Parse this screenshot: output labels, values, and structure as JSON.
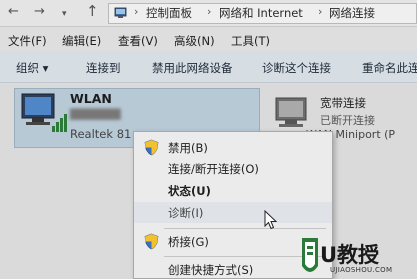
{
  "address_bar": {
    "breadcrumbs": [
      "控制面板",
      "网络和 Internet",
      "网络连接"
    ],
    "separator": "›"
  },
  "menubar": {
    "items": [
      "文件(F)",
      "编辑(E)",
      "查看(V)",
      "高级(N)",
      "工具(T)"
    ]
  },
  "toolbar": {
    "organize": "组织 ▾",
    "connect_to": "连接到",
    "disable_device": "禁用此网络设备",
    "diagnose": "诊断这个连接",
    "rename": "重命名此连"
  },
  "connections": {
    "wlan": {
      "name": "WLAN",
      "device": "Realtek 81"
    },
    "broadband": {
      "name": "宽带连接",
      "status": "已断开连接",
      "device": "WAN Miniport (P"
    }
  },
  "context_menu": {
    "items": [
      {
        "label": "禁用(B)",
        "icon": "shield-icon"
      },
      {
        "label": "连接/断开连接(O)",
        "icon": ""
      },
      {
        "label": "状态(U)",
        "icon": "",
        "bold": true
      },
      {
        "label": "诊断(I)",
        "icon": ""
      },
      {
        "label": "桥接(G)",
        "icon": "shield-icon"
      },
      {
        "label": "创建快捷方式(S)",
        "icon": ""
      }
    ]
  },
  "watermark": {
    "brand": "U教授",
    "url": "UJIAOSHOU.COM"
  },
  "colors": {
    "selection": "#b8c9d6",
    "toolbar": "#d6dde3",
    "accent": "#2b7a3a"
  }
}
